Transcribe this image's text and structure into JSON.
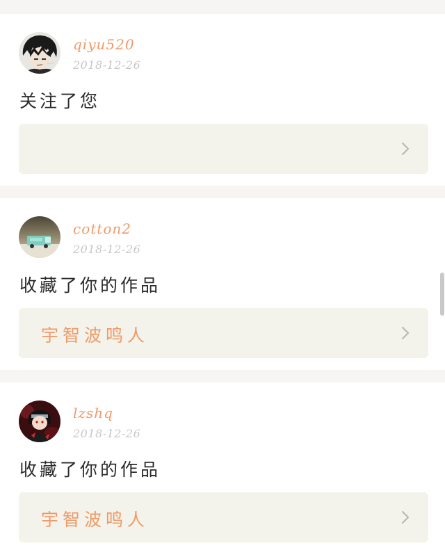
{
  "feed": {
    "items": [
      {
        "username": "qiyu520",
        "date": "2018-12-26",
        "action": "关注了您",
        "link_title": "",
        "avatar_icon": "dark-hair-character-avatar"
      },
      {
        "username": "cotton2",
        "date": "2018-12-26",
        "action": "收藏了你的作品",
        "link_title": "宇智波鸣人",
        "avatar_icon": "mint-truck-avatar"
      },
      {
        "username": "lzshq",
        "date": "2018-12-26",
        "action": "收藏了你的作品",
        "link_title": "宇智波鸣人",
        "avatar_icon": "red-cloak-character-avatar"
      }
    ]
  },
  "colors": {
    "accent": "#ef9a68",
    "date": "#c9c6c6",
    "link_box": "#f4f3eb",
    "separator": "#f7f4f4"
  }
}
